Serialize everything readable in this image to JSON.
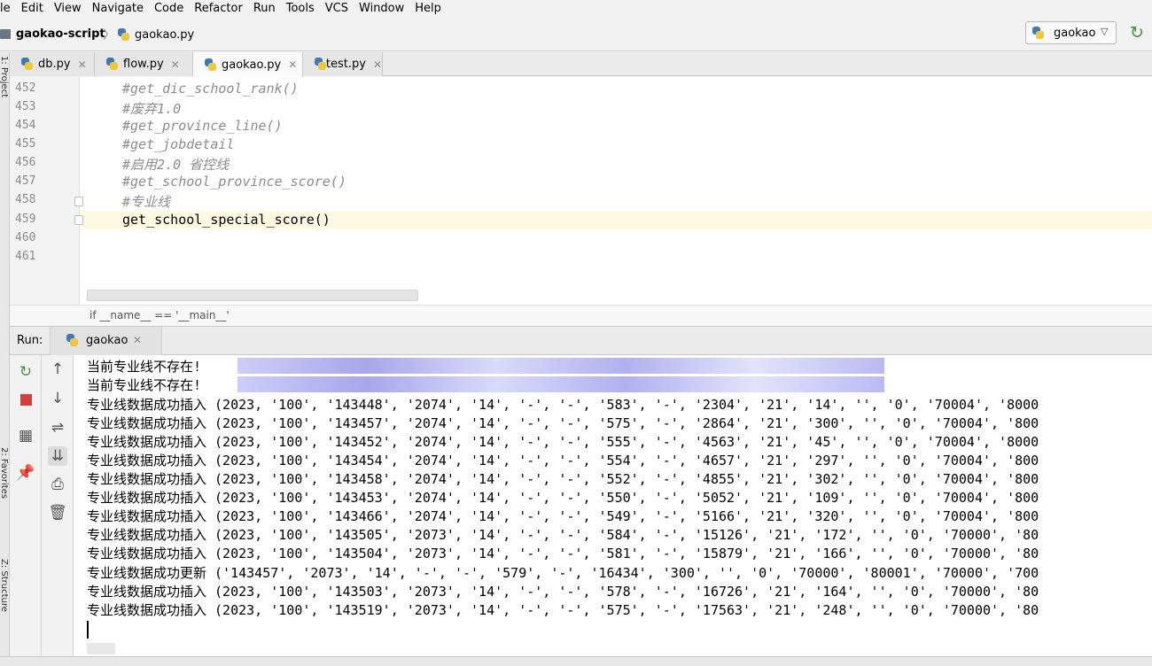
{
  "menu": [
    "le",
    "Edit",
    "View",
    "Navigate",
    "Code",
    "Refactor",
    "Run",
    "Tools",
    "VCS",
    "Window",
    "Help"
  ],
  "nav": {
    "project": "gaokao-script",
    "file": "gaokao.py",
    "run_config": "gaokao"
  },
  "left_stripe": {
    "project_label": "1: Project",
    "favorites_label": "2: Favorites",
    "structure_label": "Z: Structure"
  },
  "tabs": [
    {
      "label": "db.py"
    },
    {
      "label": "flow.py"
    },
    {
      "label": "gaokao.py"
    },
    {
      "label": "test.py"
    }
  ],
  "editor": {
    "lines": [
      {
        "no": "452",
        "text": "#get_dic_school_rank()",
        "kind": "comment"
      },
      {
        "no": "453",
        "text": "#废弃1.0",
        "kind": "comment"
      },
      {
        "no": "454",
        "text": "#get_province_line()",
        "kind": "comment"
      },
      {
        "no": "455",
        "text": "#get_jobdetail",
        "kind": "comment"
      },
      {
        "no": "456",
        "text": "#启用2.0 省控线",
        "kind": "comment"
      },
      {
        "no": "457",
        "text": "#get_school_province_score()",
        "kind": "comment"
      },
      {
        "no": "458",
        "text": "#专业线",
        "kind": "comment"
      },
      {
        "no": "459",
        "text": "get_school_special_score()",
        "kind": "code"
      },
      {
        "no": "460",
        "text": "",
        "kind": "code"
      },
      {
        "no": "461",
        "text": "",
        "kind": "code"
      }
    ],
    "breadcrumb": "if __name__ == '__main__'"
  },
  "run": {
    "title": "Run:",
    "tab_label": "gaokao",
    "console": [
      "当前专业线不存在!",
      "当前专业线不存在!",
      "专业线数据成功插入 (2023, '100', '143448', '2074', '14', '-', '-', '583', '-', '2304', '21', '14', '', '0', '70004', '8000",
      "专业线数据成功插入 (2023, '100', '143457', '2074', '14', '-', '-', '575', '-', '2864', '21', '300', '', '0', '70004', '800",
      "专业线数据成功插入 (2023, '100', '143452', '2074', '14', '-', '-', '555', '-', '4563', '21', '45', '', '0', '70004', '8000",
      "专业线数据成功插入 (2023, '100', '143454', '2074', '14', '-', '-', '554', '-', '4657', '21', '297', '', '0', '70004', '800",
      "专业线数据成功插入 (2023, '100', '143458', '2074', '14', '-', '-', '552', '-', '4855', '21', '302', '', '0', '70004', '800",
      "专业线数据成功插入 (2023, '100', '143453', '2074', '14', '-', '-', '550', '-', '5052', '21', '109', '', '0', '70004', '800",
      "专业线数据成功插入 (2023, '100', '143466', '2074', '14', '-', '-', '549', '-', '5166', '21', '320', '', '0', '70004', '800",
      "专业线数据成功插入 (2023, '100', '143505', '2073', '14', '-', '-', '584', '-', '15126', '21', '172', '', '0', '70000', '80",
      "专业线数据成功插入 (2023, '100', '143504', '2073', '14', '-', '-', '581', '-', '15879', '21', '166', '', '0', '70000', '80",
      "专业线数据成功更新 ('143457', '2073', '14', '-', '-', '579', '-', '16434', '300', '', '0', '70000', '80001', '70000', '700",
      "专业线数据成功插入 (2023, '100', '143503', '2073', '14', '-', '-', '578', '-', '16726', '21', '164', '', '0', '70000', '80",
      "专业线数据成功插入 (2023, '100', '143519', '2073', '14', '-', '-', '575', '-', '17563', '21', '248', '', '0', '70000', '80"
    ]
  },
  "colors": {
    "comment": "#8c8c8c",
    "current_line": "#fffae3",
    "rerun": "#3a9a3a",
    "stop": "#db3b3b"
  }
}
